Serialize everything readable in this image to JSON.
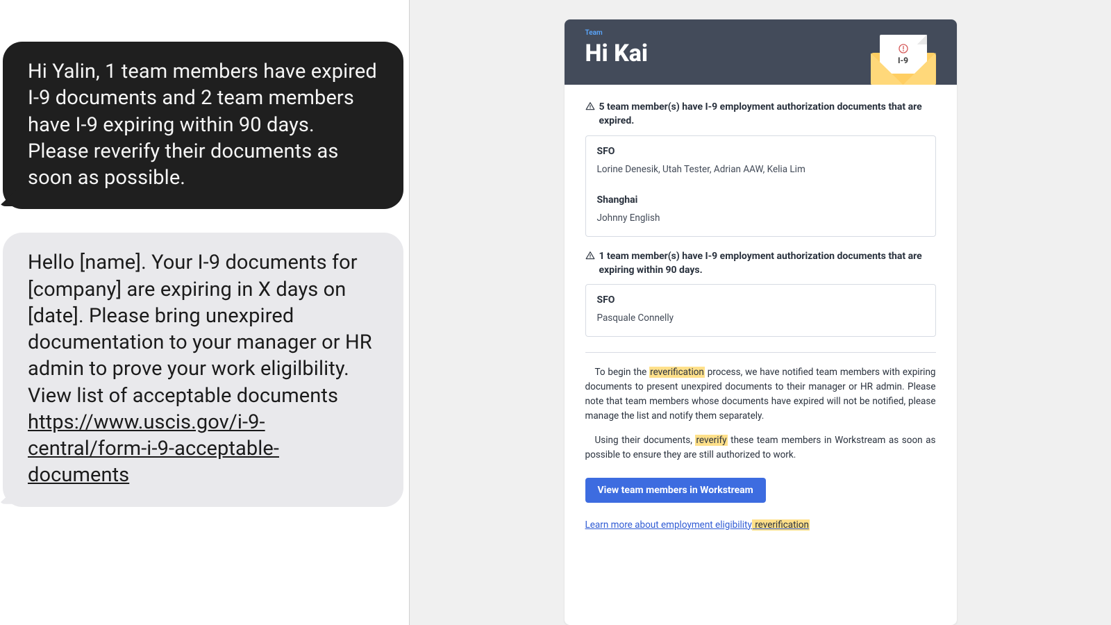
{
  "sms": {
    "dark": "Hi Yalin,  1 team members have expired I-9 documents and 2 team members have I-9 expiring within 90 days. Please reverify their documents as soon as possible.",
    "light_before_link": "Hello [name]. Your I-9 documents for [company] are expiring in X days on [date]. Please bring unexpired documentation to your manager or HR admin to prove your work eligilbility. View list of acceptable documents ",
    "light_link": "https://www.uscis.gov/i-9-central/form-i-9-acceptable-documents"
  },
  "email": {
    "eyebrow": "Team",
    "greeting": "Hi Kai",
    "envelope_label": "I-9",
    "expired": {
      "headline": "5 team member(s) have I-9 employment authorization documents that are expired.",
      "locations": [
        {
          "name": "SFO",
          "members": "Lorine Denesik, Utah Tester, Adrian AAW, Kelia Lim"
        },
        {
          "name": "Shanghai",
          "members": "Johnny English"
        }
      ]
    },
    "expiring": {
      "headline": "1 team member(s) have I-9 employment authorization documents that are expiring within 90 days.",
      "locations": [
        {
          "name": "SFO",
          "members": "Pasquale Connelly"
        }
      ]
    },
    "para1_before": "To begin the ",
    "para1_hl": "reverification",
    "para1_after": " process, we have notified team members with expiring documents to present unexpired documents to their manager or HR admin. Please note that team members whose documents have expired will not be notified, please manage the list and notify them separately.",
    "para2_before": "Using their documents, ",
    "para2_hl": "reverify",
    "para2_after": " these team members in Workstream as soon as possible to ensure they are still authorized to work.",
    "cta": "View team members in Workstream",
    "learn_before": "Learn more about employment eligibility",
    "learn_hl": " reverification"
  }
}
